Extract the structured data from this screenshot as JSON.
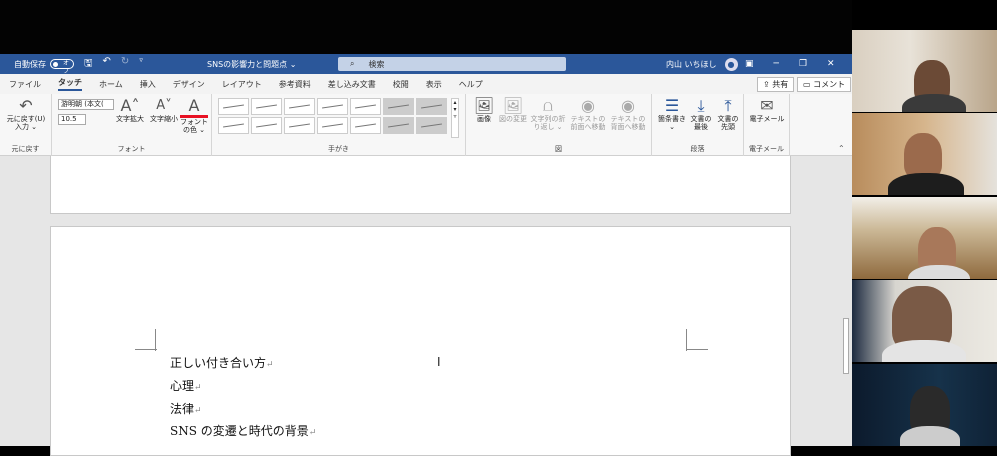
{
  "titlebar": {
    "autosave_label": "自動保存",
    "autosave_state": "オフ",
    "save_icon": "save-icon",
    "undo_icon": "undo-icon",
    "redo_icon": "redo-icon",
    "doc_title": "SNSの影響力と問題点",
    "doc_title_caret": "⌄",
    "search_placeholder": "検索",
    "user_name": "内山 いちほし"
  },
  "tabs": [
    "ファイル",
    "タッチ",
    "ホーム",
    "挿入",
    "デザイン",
    "レイアウト",
    "参考資料",
    "差し込み文書",
    "校閲",
    "表示",
    "ヘルプ"
  ],
  "share_label": "共有",
  "comment_label": "コメント",
  "ribbon": {
    "undo_label": "元に戻す(U)",
    "undo_sub": "入力 ⌄",
    "group_undo": "元に戻す",
    "font_name": "游明朝 (本文(",
    "font_size": "10.5",
    "grow_label": "文字拡大",
    "shrink_label": "文字縮小",
    "color_label": "フォント",
    "color_sub": "の色 ⌄",
    "group_font": "フォント",
    "group_ink": "手がき",
    "image_label": "画像",
    "change_image_label": "図の変更",
    "wrap_label": "文字列の折",
    "wrap_sub": "り返し ⌄",
    "front_label": "テキストの",
    "front_sub": "前面へ移動",
    "back_label": "テキストの",
    "back_sub": "背面へ移動",
    "group_image": "図",
    "bullets_label": "箇条書き",
    "bullets_sub": "⌄",
    "doc_end_label": "文書の",
    "doc_end_sub": "最後",
    "doc_start_label": "文書の",
    "doc_start_sub": "先頭",
    "group_paragraph": "段落",
    "email_label": "電子メール",
    "group_email": "電子メール"
  },
  "document": {
    "lines": [
      "正しい付き合い方",
      "心理",
      "法律",
      "SNS の変遷と時代の背景"
    ],
    "para_mark": "↵"
  },
  "colors": {
    "titlebar": "#2b579a",
    "ribbon": "#f7f7f7",
    "font_color_bar": "#e81123"
  }
}
